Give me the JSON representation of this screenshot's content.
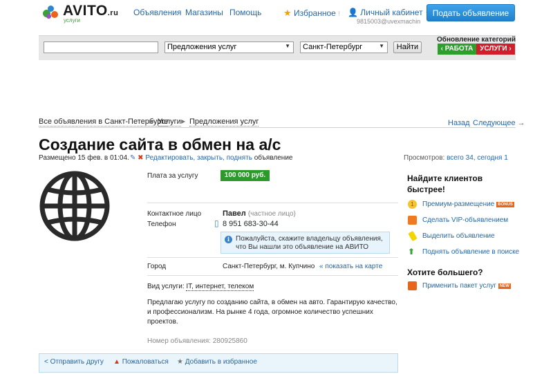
{
  "header": {
    "logo_text": "AVITO",
    "logo_suffix": ".ru",
    "logo_sub": "услуги",
    "nav": [
      "Объявления",
      "Магазины",
      "Помощь"
    ],
    "favorites": "Избранное",
    "cabinet": "Личный кабинет",
    "email": "9815003@uvexmachin",
    "post_button": "Подать объявление"
  },
  "search": {
    "query": "",
    "category": "Предложения услуг",
    "city": "Санкт-Петербург",
    "find_button": "Найти"
  },
  "category_update": {
    "title": "Обновление категорий",
    "work": "РАБОТА",
    "services": "УСЛУГИ"
  },
  "breadcrumbs": [
    "Все объявления в Санкт-Петербурге",
    "Услуги",
    "Предложения услуг"
  ],
  "pager": {
    "back": "Назад",
    "next": "Следующее →"
  },
  "ad": {
    "title": "Создание сайта в обмен на а/с",
    "posted": "Размещено 15 фев. в 01:04.",
    "edit_link": "Редактировать, закрыть, поднять",
    "edit_tail": "объявление",
    "views_label": "Просмотров:",
    "views_value": "всего 34, сегодня 1",
    "price_label": "Плата за услугу",
    "price": "100 000 руб.",
    "contact_label": "Контактное лицо",
    "contact_name": "Павел",
    "contact_note": "(частное лицо)",
    "phone_label": "Телефон",
    "phone": "8 951 683-30-44",
    "notice": "Пожалуйста, скажите владельцу объявления, что Вы нашли это объявление на АВИТО",
    "city_label": "Город",
    "city": "Санкт-Петербург, м. Купчино",
    "map_link": "показать на карте",
    "service_type_label": "Вид услуги:",
    "service_type": "IT, интернет, телеком",
    "description": "Предлагаю услугу по созданию сайта, в обмен на авто. Гарантирую качество, и профессионализм. На рынке 4 года, огромное количество успешних проектов.",
    "ad_number": "Номер объявления: 280925860"
  },
  "sidebar": {
    "heading1": "Найдите клиентов быстрее!",
    "items": [
      {
        "label": "Премиум-размещение",
        "tag": "BONUS",
        "icon_color": "#f4c430"
      },
      {
        "label": "Сделать VIP-объявлением",
        "tag": "",
        "icon_color": "#f07a20"
      },
      {
        "label": "Выделить объявление",
        "tag": "",
        "icon_color": "#f2d400"
      },
      {
        "label": "Поднять объявление в поиске",
        "tag": "",
        "icon_color": "#3aa03a"
      }
    ],
    "heading2": "Хотите большего?",
    "package": {
      "label": "Применить пакет услуг",
      "tag": "NEW"
    }
  },
  "actions": {
    "share": "Отправить другу",
    "complain": "Пожаловаться",
    "favorite": "Добавить в избранное"
  }
}
